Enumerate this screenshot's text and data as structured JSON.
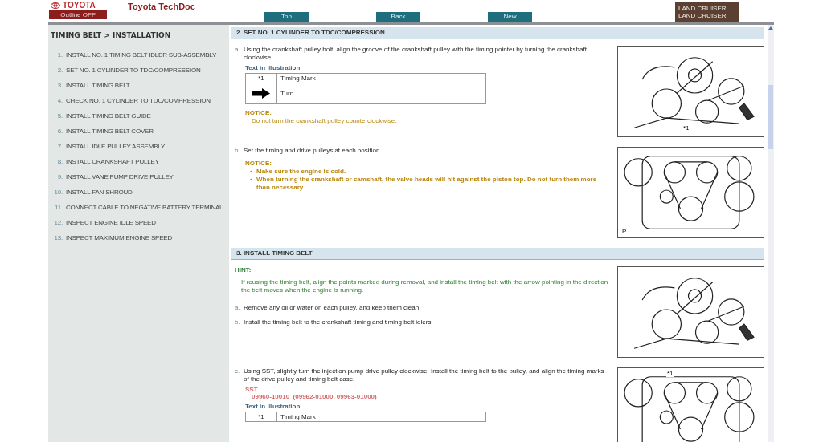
{
  "header": {
    "logo": "TOYOTA",
    "outline_button": "Outline OFF",
    "app_title": "Toyota TechDoc",
    "nav_buttons": [
      "Top",
      "Back",
      "New"
    ],
    "model_tab": [
      "LAND CRUISER,",
      "LAND CRUISER"
    ]
  },
  "sidebar": {
    "title": "TIMING BELT > INSTALLATION",
    "items": [
      {
        "number": "1.",
        "label": "INSTALL NO. 1 TIMING BELT IDLER SUB-ASSEMBLY"
      },
      {
        "number": "2.",
        "label": "SET NO. 1 CYLINDER TO TDC/COMPRESSION"
      },
      {
        "number": "3.",
        "label": "INSTALL TIMING BELT"
      },
      {
        "number": "4.",
        "label": "CHECK NO. 1 CYLINDER TO TDC/COMPRESSION"
      },
      {
        "number": "5.",
        "label": "INSTALL TIMING BELT GUIDE"
      },
      {
        "number": "6.",
        "label": "INSTALL TIMING BELT COVER"
      },
      {
        "number": "7.",
        "label": "INSTALL IDLE PULLEY ASSEMBLY"
      },
      {
        "number": "8.",
        "label": "INSTALL CRANKSHAFT PULLEY"
      },
      {
        "number": "9.",
        "label": "INSTALL VANE PUMP DRIVE PULLEY"
      },
      {
        "number": "10.",
        "label": "INSTALL FAN SHROUD"
      },
      {
        "number": "11.",
        "label": "CONNECT CABLE TO NEGATIVE BATTERY TERMINAL"
      },
      {
        "number": "12.",
        "label": "INSPECT ENGINE IDLE SPEED"
      },
      {
        "number": "13.",
        "label": "INSPECT MAXIMUM ENGINE SPEED"
      }
    ]
  },
  "sections": [
    {
      "heading": "2. SET NO. 1 CYLINDER TO TDC/COMPRESSION",
      "rows": [
        {
          "figure": {
            "label": "*1"
          },
          "blocks": [
            {
              "kind": "step",
              "letter": "a.",
              "text": "Using the crankshaft pulley bolt, align the groove of the crankshaft pulley with the timing pointer by turning the crankshaft clockwise."
            },
            {
              "kind": "illus_table",
              "title": "Text in Illustration",
              "rows": [
                {
                  "key": "*1",
                  "text": "Timing Mark"
                },
                {
                  "text": "Turn"
                }
              ]
            },
            {
              "kind": "notice",
              "title": "NOTICE:",
              "lines": [
                "Do not turn the crankshaft pulley counterclockwise."
              ]
            }
          ]
        },
        {
          "figure": {
            "label": "P"
          },
          "blocks": [
            {
              "kind": "step",
              "letter": "b.",
              "text": "Set the timing and drive pulleys at each position."
            },
            {
              "kind": "notice_bullets",
              "title": "NOTICE:",
              "bullet": "•",
              "lines": [
                "Make sure the engine is cold.",
                "When turning the crankshaft or camshaft, the valve heads will hit against the piston top. Do not turn them more than necessary."
              ]
            }
          ]
        }
      ]
    },
    {
      "heading": "3. INSTALL TIMING BELT",
      "rows": [
        {
          "figure": {},
          "blocks": [
            {
              "kind": "hint",
              "title": "HINT:",
              "text": "If reusing the timing belt, align the points marked during removal, and install the timing belt with the arrow pointing in the direction the belt moves when the engine is running."
            },
            {
              "kind": "step",
              "letter": "a.",
              "text": "Remove any oil or water on each pulley, and keep them clean."
            },
            {
              "kind": "step",
              "letter": "b.",
              "text": "Install the timing belt to the crankshaft timing and timing belt idlers."
            }
          ]
        },
        {
          "figure": {
            "label": "*1"
          },
          "blocks": [
            {
              "kind": "step",
              "letter": "c.",
              "text": "Using SST, slightly turn the injection pump drive pulley clockwise. Install the timing belt to the pulley, and align the timing marks of the drive pulley and timing belt case."
            },
            {
              "kind": "sst",
              "title": "SST",
              "text": "09960-10010  (09962-01000, 09963-01000)"
            },
            {
              "kind": "illus_table",
              "title": "Text in Illustration",
              "rows": [
                {
                  "key": "*1",
                  "text": "Timing Mark"
                }
              ]
            }
          ]
        }
      ]
    }
  ]
}
